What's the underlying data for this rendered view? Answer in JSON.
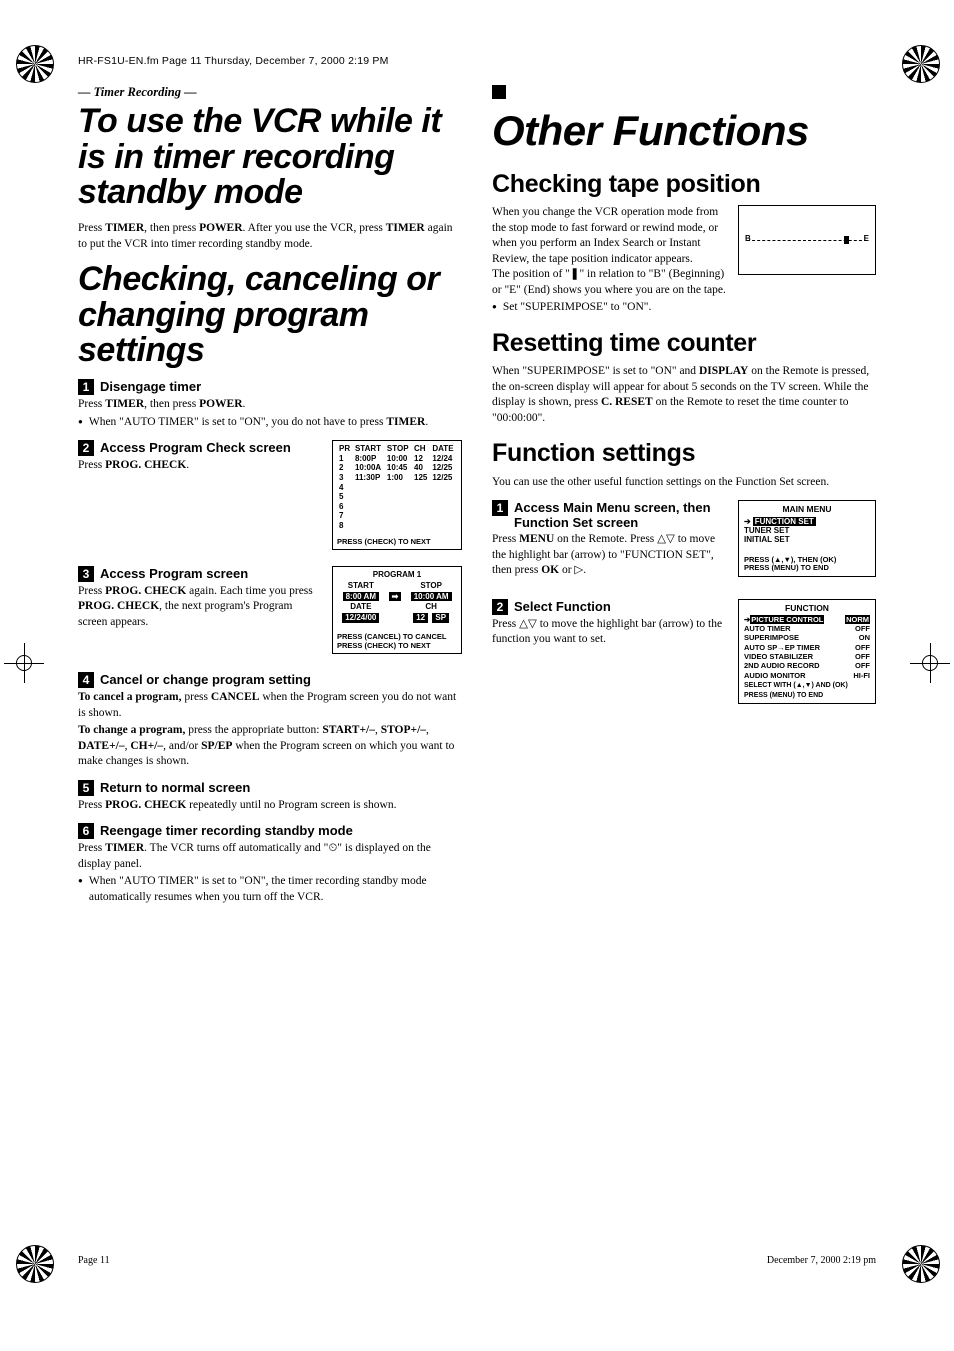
{
  "header": "HR-FS1U-EN.fm  Page 11  Thursday, December 7, 2000  2:19 PM",
  "left": {
    "tag": "— Timer Recording —",
    "h1a": "To use the VCR while it is in timer recording standby mode",
    "p1_parts": [
      "Press ",
      "TIMER",
      ", then press ",
      "POWER",
      ". After you use the VCR, press ",
      "TIMER",
      " again to put the VCR into timer recording standby mode."
    ],
    "h1b": "Checking, canceling or changing program settings",
    "steps": [
      {
        "n": "1",
        "t": "Disengage timer",
        "body_parts": [
          "Press ",
          "TIMER",
          ", then press ",
          "POWER",
          "."
        ],
        "bullet_parts": [
          "When \"AUTO TIMER\" is set to \"ON\", you do not have to press ",
          "TIMER",
          "."
        ]
      },
      {
        "n": "2",
        "t": "Access Program Check screen",
        "body_parts": [
          "Press ",
          "PROG. CHECK",
          "."
        ]
      },
      {
        "n": "3",
        "t": "Access Program screen",
        "body_parts": [
          "Press ",
          "PROG. CHECK",
          " again. Each time you press ",
          "PROG. CHECK",
          ", the next program's Program screen appears."
        ]
      },
      {
        "n": "4",
        "t": "Cancel or change program setting",
        "body_html": true,
        "body_a_parts": [
          "To cancel a program,",
          " press ",
          "CANCEL",
          " when the Program screen you do not want is shown."
        ],
        "body_b_parts": [
          "To change a program,",
          " press the appropriate button: ",
          "START+/–",
          ", ",
          "STOP+/–",
          ", ",
          "DATE+/–",
          ", ",
          "CH+/–",
          ", and/or ",
          "SP/EP",
          " when the Program screen on which you want to make changes is shown."
        ]
      },
      {
        "n": "5",
        "t": "Return to normal screen",
        "body_parts": [
          "Press ",
          "PROG. CHECK",
          " repeatedly until no Program screen is shown."
        ]
      },
      {
        "n": "6",
        "t": "Reengage timer recording standby mode",
        "body_parts": [
          "Press ",
          "TIMER",
          ". The VCR turns off automatically and \"⏲\" is displayed on the display panel."
        ],
        "bullet_parts": [
          "When \"AUTO TIMER\" is set to \"ON\", the timer recording standby mode automatically resumes when you turn off the VCR."
        ]
      }
    ],
    "check_table": {
      "headers": [
        "PR",
        "START",
        "STOP",
        "CH",
        "DATE"
      ],
      "rows": [
        [
          "1",
          "8:00P",
          "10:00",
          "12",
          "12/24"
        ],
        [
          "2",
          "10:00A",
          "10:45",
          "40",
          "12/25"
        ],
        [
          "3",
          "11:30P",
          "1:00",
          "125",
          "12/25"
        ],
        [
          "4",
          "",
          "",
          "",
          ""
        ],
        [
          "5",
          "",
          "",
          "",
          ""
        ],
        [
          "6",
          "",
          "",
          "",
          ""
        ],
        [
          "7",
          "",
          "",
          "",
          ""
        ],
        [
          "8",
          "",
          "",
          "",
          ""
        ]
      ],
      "footer": "PRESS (CHECK) TO NEXT"
    },
    "prog_box": {
      "title": "PROGRAM 1",
      "labels": {
        "start": "START",
        "stop": "STOP",
        "date": "DATE",
        "ch": "CH"
      },
      "values": {
        "start": "8:00 AM",
        "stop": "10:00 AM",
        "date": "12/24/00",
        "ch": "12",
        "mode": "SP",
        "arrow": "➡"
      },
      "footer1": "PRESS (CANCEL) TO CANCEL",
      "footer2": "PRESS (CHECK) TO NEXT"
    }
  },
  "right": {
    "chapter": "Other Functions",
    "h2a": "Checking tape position",
    "p_a": "When you change the VCR operation mode from the stop mode to fast forward or rewind mode, or when you perform an Index Search or Instant Review, the tape position indicator appears.",
    "p_a2": "The position of \"❚\" in relation to \"B\" (Beginning) or \"E\" (End) shows you where you are on the tape.",
    "bullet_a": "Set \"SUPERIMPOSE\" to \"ON\".",
    "tape": {
      "b": "B",
      "e": "E"
    },
    "h2b": "Resetting time counter",
    "p_b_parts": [
      "When \"SUPERIMPOSE\" is set to \"ON\" and ",
      "DISPLAY",
      " on the Remote is pressed, the on-screen display will appear for about 5 seconds on the TV screen. While the display is shown, press ",
      "C. RESET",
      " on the Remote to reset the time counter to \"00:00:00\"."
    ],
    "h2c": "Function settings",
    "p_c": "You can use the other useful function settings on the Function Set screen.",
    "step1": {
      "n": "1",
      "t": "Access Main Menu screen, then Function Set screen",
      "body_parts": [
        "Press ",
        "MENU",
        " on the Remote. Press △▽ to move the highlight bar (arrow) to \"FUNCTION SET\", then press ",
        "OK",
        " or ▷."
      ]
    },
    "step2": {
      "n": "2",
      "t": "Select Function",
      "body": "Press △▽ to move the highlight bar (arrow) to the function you want to set."
    },
    "menu_box": {
      "title": "MAIN MENU",
      "items": [
        "FUNCTION SET",
        "TUNER SET",
        "INITIAL SET"
      ],
      "foot1": "PRESS (▲,▼), THEN (OK)",
      "foot2": "PRESS (MENU) TO END"
    },
    "func_box": {
      "title": "FUNCTION",
      "rows": [
        [
          "PICTURE CONTROL",
          "NORM"
        ],
        [
          "AUTO TIMER",
          "OFF"
        ],
        [
          "SUPERIMPOSE",
          "ON"
        ],
        [
          "AUTO SP→EP TIMER",
          "OFF"
        ],
        [
          "VIDEO STABILIZER",
          "OFF"
        ],
        [
          "2ND AUDIO RECORD",
          "OFF"
        ],
        [
          "AUDIO MONITOR",
          "HI-FI"
        ]
      ],
      "foot1": "SELECT WITH (▲,▼) AND (OK)",
      "foot2": "PRESS (MENU) TO END"
    }
  },
  "footer": {
    "left": "Page 11",
    "right": "December 7, 2000 2:19 pm"
  }
}
